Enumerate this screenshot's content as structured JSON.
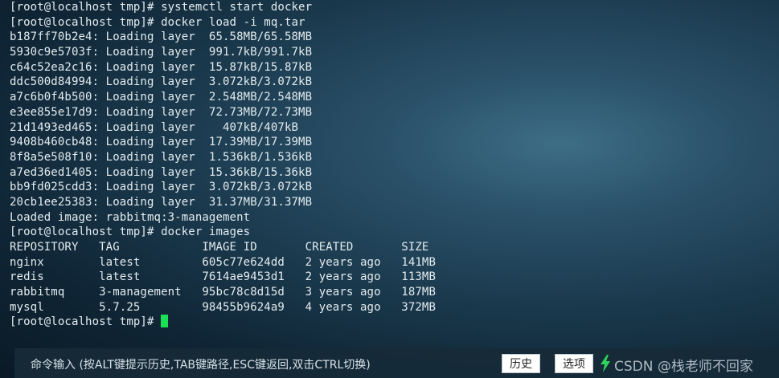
{
  "terminal": {
    "lines": [
      "[root@localhost tmp]# systemctl start docker",
      "[root@localhost tmp]# docker load -i mq.tar",
      "b187ff70b2e4: Loading layer  65.58MB/65.58MB",
      "5930c9e5703f: Loading layer  991.7kB/991.7kB",
      "c64c52ea2c16: Loading layer  15.87kB/15.87kB",
      "ddc500d84994: Loading layer  3.072kB/3.072kB",
      "a7c6b0f4b500: Loading layer  2.548MB/2.548MB",
      "e3ee855e17d9: Loading layer  72.73MB/72.73MB",
      "21d1493ed465: Loading layer    407kB/407kB",
      "9408b460cb48: Loading layer  17.39MB/17.39MB",
      "8f8a5e508f10: Loading layer  1.536kB/1.536kB",
      "a7ed36ed1405: Loading layer  15.36kB/15.36kB",
      "bb9fd025cdd3: Loading layer  3.072kB/3.072kB",
      "20cb1ee25383: Loading layer  31.37MB/31.37MB",
      "Loaded image: rabbitmq:3-management",
      "[root@localhost tmp]# docker images",
      "REPOSITORY   TAG            IMAGE ID       CREATED       SIZE",
      "nginx        latest         605c77e624dd   2 years ago   141MB",
      "redis        latest         7614ae9453d1   2 years ago   113MB",
      "rabbitmq     3-management   95bc78c8d15d   3 years ago   187MB",
      "mysql        5.7.25         98455b9624a9   4 years ago   372MB"
    ],
    "prompt": "[root@localhost tmp]# "
  },
  "bottom_bar": {
    "hint": "命令输入 (按ALT键提示历史,TAB键路径,ESC键返回,双击CTRL切换)",
    "history_label": "历史",
    "options_label": "选项",
    "watermark": "CSDN @栈老师不回家"
  },
  "colors": {
    "cursor": "#19e055",
    "bolt": "#2fd35a"
  },
  "icons": {
    "bolt": "lightning-bolt-icon"
  }
}
